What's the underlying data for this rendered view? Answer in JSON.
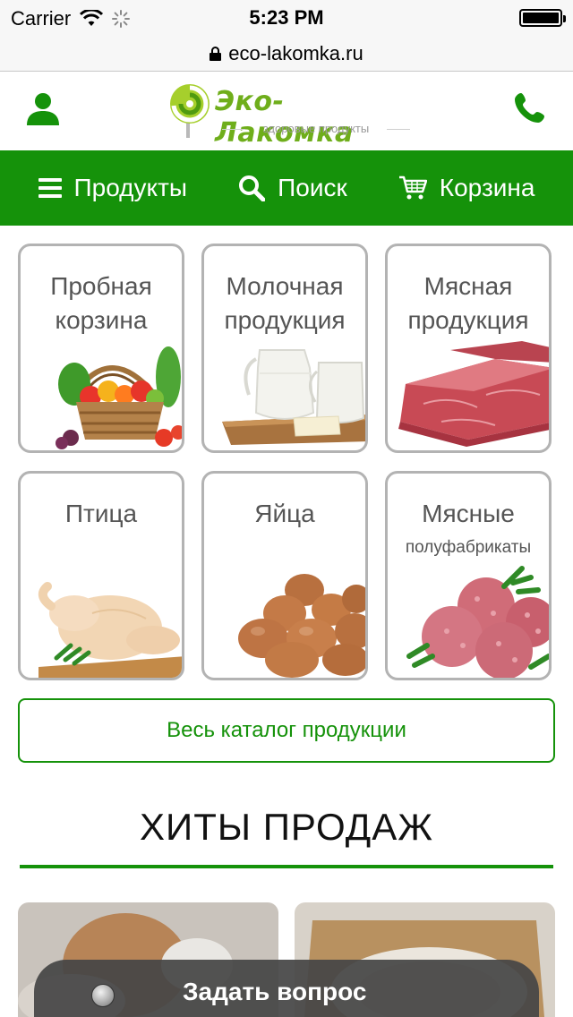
{
  "status_bar": {
    "carrier": "Carrier",
    "time": "5:23 PM"
  },
  "browser": {
    "url": "eco-lakomka.ru"
  },
  "logo": {
    "title": "Эко-Лакомка",
    "subtitle": "здоровые продукты"
  },
  "nav": {
    "items": [
      {
        "label": "Продукты",
        "icon": "menu-icon"
      },
      {
        "label": "Поиск",
        "icon": "search-icon"
      },
      {
        "label": "Корзина",
        "icon": "cart-icon"
      }
    ]
  },
  "categories": [
    {
      "title": "Пробная корзина",
      "image": "vegetable-basket"
    },
    {
      "title": "Молочная продукция",
      "image": "milk-jugs"
    },
    {
      "title": "Мясная продукция",
      "image": "raw-beef"
    },
    {
      "title": "Птица",
      "image": "raw-chicken"
    },
    {
      "title": "Яйца",
      "image": "eggs"
    },
    {
      "title": "Мясные",
      "subtitle": "полуфабрикаты",
      "image": "meatballs"
    }
  ],
  "catalog_button": "Весь каталог продукции",
  "hits": {
    "title": "ХИТЫ ПРОДАЖ"
  },
  "ask_button": "Задать вопрос",
  "colors": {
    "brand_green": "#15920a",
    "logo_green": "#6fae1b",
    "card_border": "#b3b3b3"
  }
}
